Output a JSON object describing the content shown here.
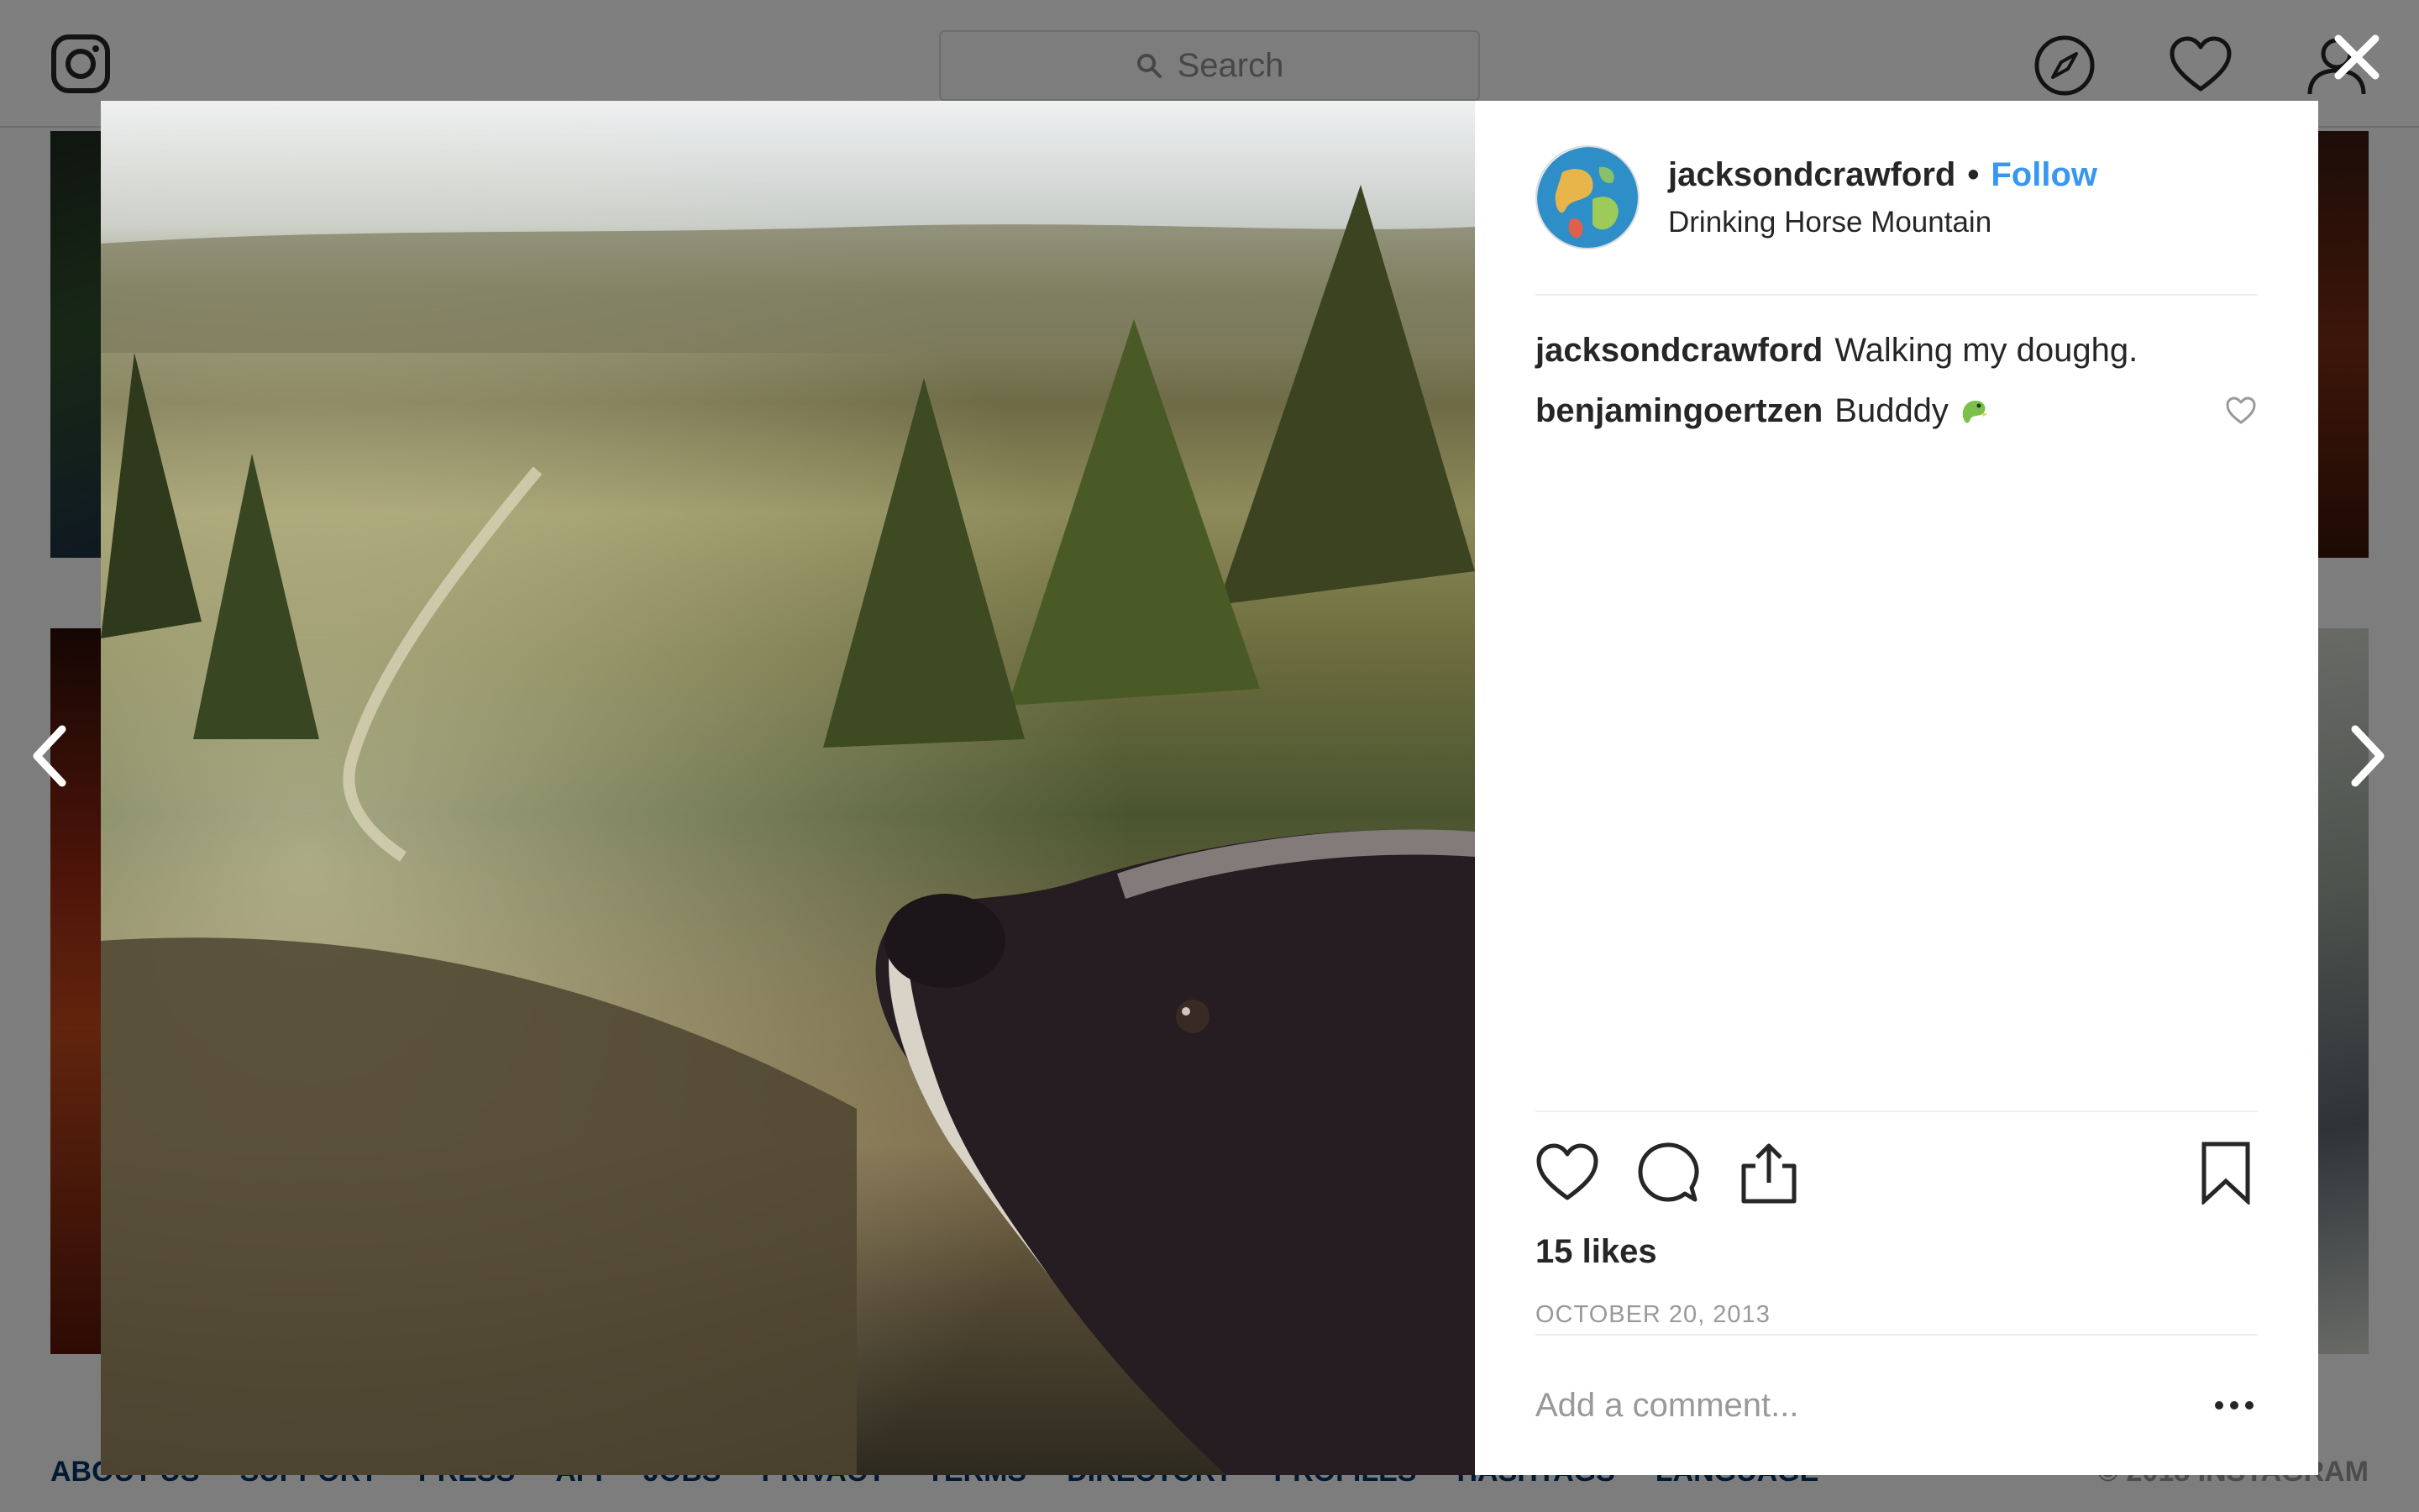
{
  "topbar": {
    "search_placeholder": "Search"
  },
  "footer": {
    "links": [
      "About us",
      "Support",
      "Press",
      "API",
      "Jobs",
      "Privacy",
      "Terms",
      "Directory",
      "Profiles",
      "Hashtags",
      "Language"
    ],
    "copyright": "© 2018 Instagram"
  },
  "post": {
    "username": "jacksondcrawford",
    "separator": "•",
    "follow_label": "Follow",
    "location": "Drinking Horse Mountain",
    "comments": [
      {
        "user": "jacksondcrawford",
        "text": "Walking my doughg."
      },
      {
        "user": "benjamingoertzen",
        "text": "Budddy"
      }
    ],
    "likes": "15 likes",
    "date": "OCTOBER 20, 2013",
    "comment_placeholder": "Add a comment..."
  },
  "icons": {
    "logo": "instagram-logo-icon",
    "search": "search-icon",
    "explore": "compass-icon",
    "activity": "heart-icon",
    "profile": "user-icon",
    "close": "close-icon",
    "prev": "chevron-left-icon",
    "next": "chevron-right-icon",
    "like": "heart-icon",
    "comment": "comment-bubble-icon",
    "share": "share-icon",
    "save": "bookmark-icon",
    "more": "more-horizontal-icon",
    "emoji": "dragon-emoji-icon"
  },
  "colors": {
    "accent": "#3897f0",
    "text": "#262626",
    "muted": "#999999",
    "divider": "#efefef"
  }
}
